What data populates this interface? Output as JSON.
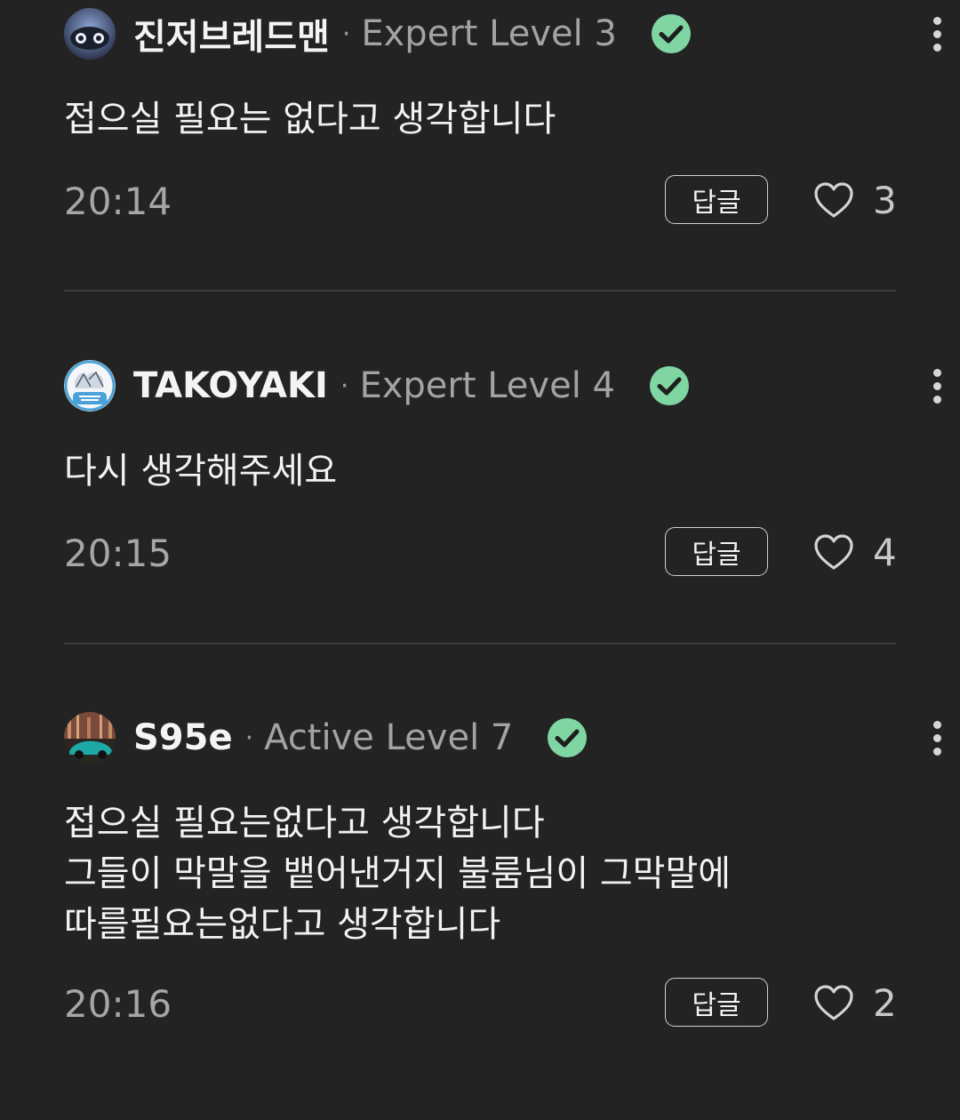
{
  "comments": [
    {
      "username": "진저브레드맨",
      "separator": "·",
      "level": "Expert Level 3",
      "body": "접으실 필요는 없다고 생각합니다",
      "time": "20:14",
      "reply_label": "답글",
      "likes": "3"
    },
    {
      "username": "TAKOYAKI",
      "separator": "·",
      "level": "Expert Level 4",
      "body": "다시 생각해주세요",
      "time": "20:15",
      "reply_label": "답글",
      "likes": "4"
    },
    {
      "username": "S95e",
      "separator": "·",
      "level": "Active Level 7",
      "body": "접으실 필요는없다고 생각합니다\n그들이 막말을 뱉어낸거지 불룸님이 그막말에\n따를필요는없다고 생각합니다",
      "time": "20:16",
      "reply_label": "답글",
      "likes": "2"
    }
  ],
  "colors": {
    "background": "#232323",
    "verified_badge": "#7fd6a2",
    "divider": "#3c3c3c"
  },
  "icons": {
    "verified": "check-circle-icon",
    "more": "more-vertical-icon",
    "like": "heart-outline-icon"
  }
}
